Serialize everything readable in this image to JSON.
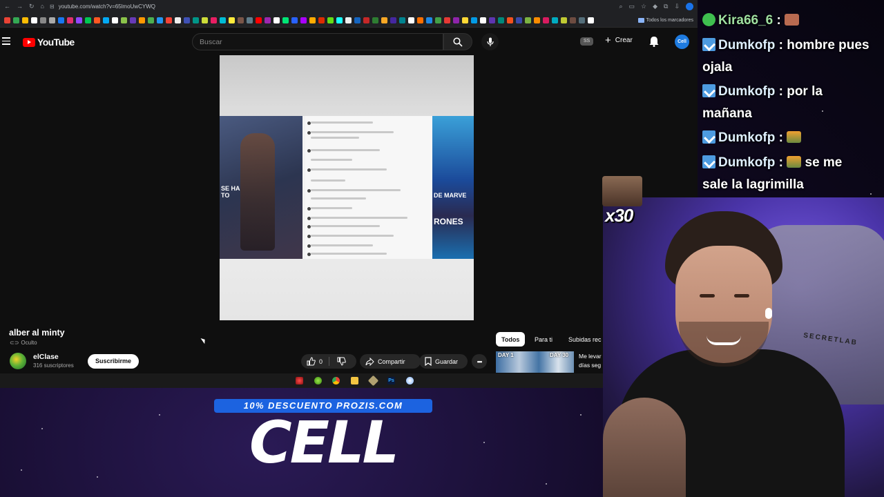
{
  "browser": {
    "url": "youtube.com/watch?v=65lmoUwCYWQ",
    "bookmarks_folder": "Todos los marcadores"
  },
  "youtube": {
    "logo_text": "YouTube",
    "search_placeholder": "Buscar",
    "ss_badge": "SS",
    "create_label": "Crear",
    "avatar_text": "Cell"
  },
  "video": {
    "title": "alber al minty",
    "visibility": "Oculto",
    "channel_name": "elClase",
    "channel_subs": "316 suscriptores",
    "subscribe_label": "Suscribirme",
    "like_count": "0",
    "share_label": "Compartir",
    "save_label": "Guardar",
    "more_label": "•••",
    "frame_text_left": "se ha",
    "frame_text_left2": "to",
    "frame_text_right1": "DE MARVE",
    "frame_text_right2": "RONES"
  },
  "chips": [
    {
      "label": "Todos",
      "active": true
    },
    {
      "label": "Para ti",
      "active": false
    },
    {
      "label": "Subidas rec",
      "active": false
    }
  ],
  "recommendation": {
    "thumb_label_left": "DAY 1",
    "thumb_label_right": "DAY 30",
    "title_line1": "Me levar",
    "title_line2": "días seg"
  },
  "promo": {
    "banner": "10% DESCUENTO PROZIS.COM",
    "logo": "CELL"
  },
  "chat": [
    {
      "user": "Kira66_6",
      "sep": " : ",
      "text": "",
      "emote": true,
      "badge": "kira"
    },
    {
      "user": "Dumkofp",
      "sep": " : ",
      "text": "hombre pues",
      "cont": "ojala",
      "badge": "dum"
    },
    {
      "user": "Dumkofp",
      "sep": " : ",
      "text": "por la",
      "cont": "mañana",
      "badge": "dum"
    },
    {
      "user": "Dumkofp",
      "sep": " : ",
      "text": "",
      "emote": true,
      "badge": "dum"
    },
    {
      "user": "Dumkofp",
      "sep": " : ",
      "text": "se me",
      "cont": "sale la lagrimilla",
      "emote": true,
      "badge": "dum"
    }
  ],
  "overlay": {
    "multiplier": "x30",
    "chair_brand": "SECRETLAB"
  },
  "colors": {
    "yt_red": "#ff0000",
    "promo_blue": "#1c63e0",
    "webcam_purple": "#7a5ee8"
  }
}
